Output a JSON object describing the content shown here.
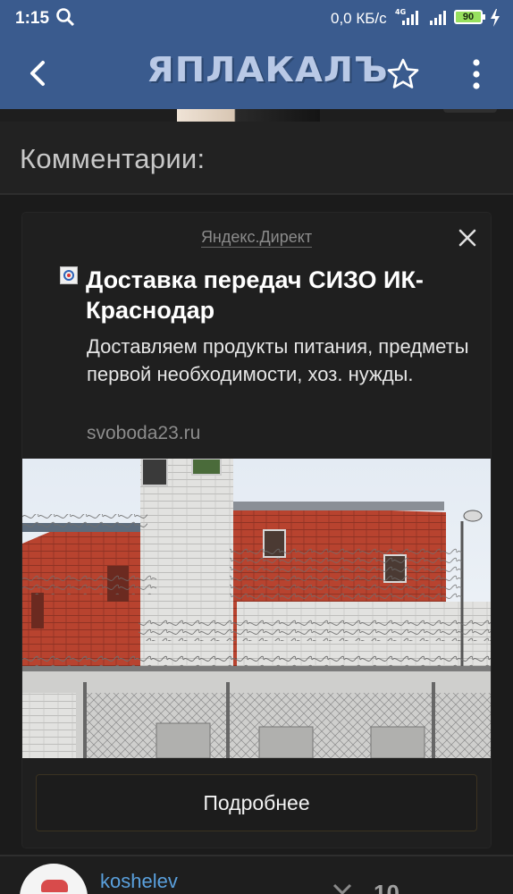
{
  "status_bar": {
    "time": "1:15",
    "network_speed": "0,0 КБ/с",
    "network_type": "4G",
    "battery_percent": "90",
    "icons": [
      "search-icon",
      "signal-4g-icon",
      "signal-icon",
      "battery-icon",
      "charging-icon"
    ]
  },
  "app_bar": {
    "logo_text": "ЯПЛАКАЛЪ",
    "icons": [
      "back-arrow-icon",
      "star-icon",
      "more-vertical-icon"
    ],
    "color": "#3a5b8e"
  },
  "comments": {
    "title": "Комментарии:"
  },
  "ad": {
    "source": "Яндекс.Директ",
    "headline": "Доставка передач СИЗО ИК-Краснодар",
    "description": "Доставляем продукты питания, предметы первой необходимости, хоз. нужды.",
    "domain": "svoboda23.ru",
    "button_label": "Подробнее",
    "icons": [
      "close-icon",
      "favicon-icon"
    ]
  },
  "first_comment": {
    "username": "koshelev",
    "rating": "10"
  }
}
